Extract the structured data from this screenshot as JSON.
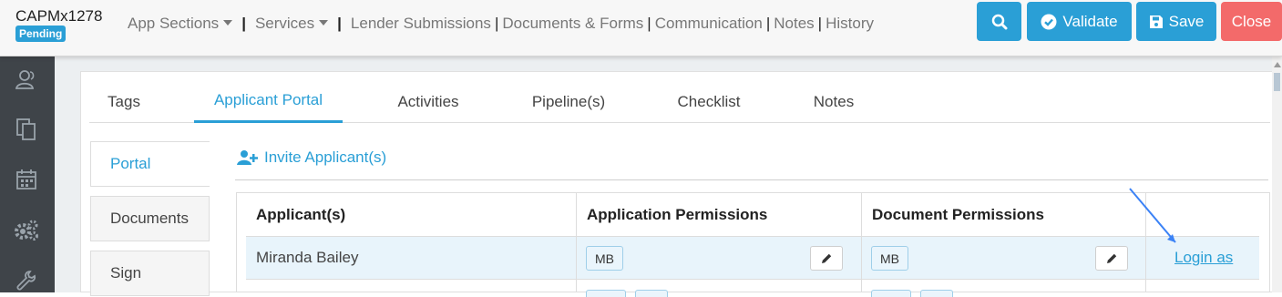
{
  "header": {
    "record_id": "CAPMx1278",
    "status": "Pending",
    "nav": [
      {
        "label": "App Sections",
        "dropdown": true
      },
      {
        "label": "Services",
        "dropdown": true
      },
      {
        "label": "Lender Submissions"
      },
      {
        "label": "Documents & Forms"
      },
      {
        "label": "Communication"
      },
      {
        "label": "Notes"
      },
      {
        "label": "History"
      }
    ],
    "buttons": {
      "search_icon": "search-icon",
      "validate": "Validate",
      "save": "Save",
      "close": "Close"
    }
  },
  "sidebar": {
    "icons": [
      "users-icon",
      "documents-icon",
      "calendar-icon",
      "gears-icon",
      "wrench-icon"
    ]
  },
  "tabs": [
    {
      "label": "Tags"
    },
    {
      "label": "Applicant Portal",
      "active": true
    },
    {
      "label": "Activities"
    },
    {
      "label": "Pipeline(s)"
    },
    {
      "label": "Checklist"
    },
    {
      "label": "Notes"
    }
  ],
  "subnav": [
    {
      "label": "Portal",
      "active": true
    },
    {
      "label": "Documents"
    },
    {
      "label": "Sign"
    }
  ],
  "portal": {
    "invite_label": "Invite Applicant(s)",
    "columns": [
      "Applicant(s)",
      "Application Permissions",
      "Document Permissions"
    ],
    "rows": [
      {
        "name": "Miranda Bailey",
        "application_permission": "MB",
        "document_permission": "MB",
        "login_label": "Login as"
      }
    ]
  },
  "colors": {
    "accent": "#2a9fd6",
    "close": "#f36a6a",
    "sidebar": "#3f4449",
    "row_highlight": "#e8f4fb"
  }
}
